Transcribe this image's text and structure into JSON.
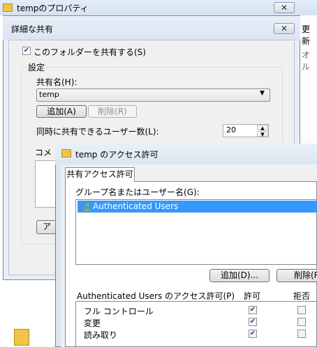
{
  "props_window": {
    "title": "tempのプロパティ",
    "close_label": "✕",
    "right_text_1": "更新",
    "right_text_2": "オル"
  },
  "advanced_sharing": {
    "title": "詳細な共有",
    "close_label": "✕",
    "share_checkbox_label": "このフォルダーを共有する(S)",
    "share_checked": true,
    "settings_label": "設定",
    "share_name_label": "共有名(H):",
    "share_name_value": "temp",
    "add_label": "追加(A)",
    "remove_label": "削除(R)",
    "users_limit_label": "同時に共有できるユーザー数(L):",
    "users_limit_value": "20",
    "comment_label": "コメ",
    "permissions_button_partial": "アク"
  },
  "permissions": {
    "title": "temp のアクセス許可",
    "tab_label": "共有アクセス許可",
    "group_label": "グループ名またはユーザー名(G):",
    "users": [
      {
        "name": "Authenticated Users",
        "icon": "user-group-icon",
        "selected": true
      }
    ],
    "add_label": "追加(D)...",
    "remove_label": "削除(R",
    "perm_for_label": "Authenticated Users のアクセス許可(P)",
    "allow_header": "許可",
    "deny_header": "拒否",
    "rows": [
      {
        "name": "フル コントロール",
        "allow": true,
        "deny": false
      },
      {
        "name": "変更",
        "allow": true,
        "deny": false
      },
      {
        "name": "読み取り",
        "allow": true,
        "deny": false
      }
    ]
  }
}
